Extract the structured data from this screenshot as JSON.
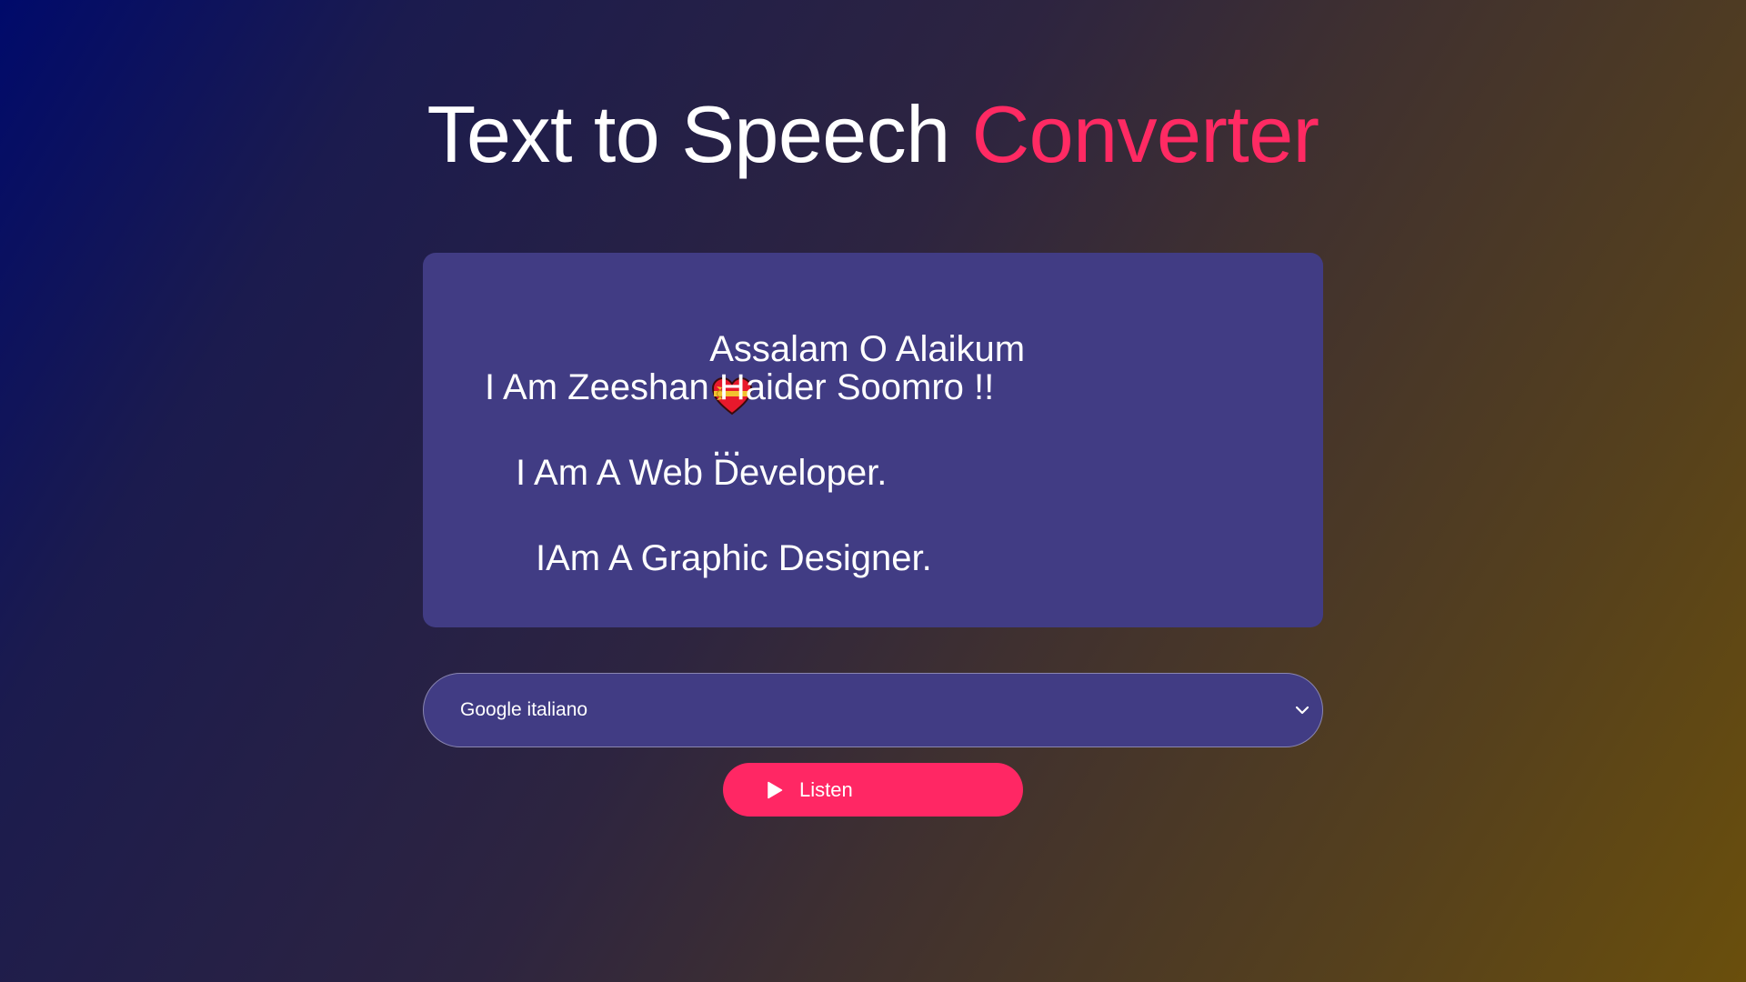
{
  "header": {
    "title_main": "Text to Speech ",
    "title_accent": "Converter",
    "accent_color": "#ff2a63"
  },
  "textarea": {
    "lines": [
      "Assalam O Alaikum",
      "...",
      "I Am Zeeshan Haider Soomro !!",
      "I Am A Web Developer.",
      "IAm A Graphic Designer."
    ],
    "emoji_icon": "heart-with-ribbon-icon"
  },
  "voice_select": {
    "selected": "Google italiano",
    "icon": "chevron-down-icon"
  },
  "listen_button": {
    "label": "Listen",
    "icon": "play-icon",
    "color": "#ff2764"
  },
  "colors": {
    "panel": "#413c84"
  }
}
